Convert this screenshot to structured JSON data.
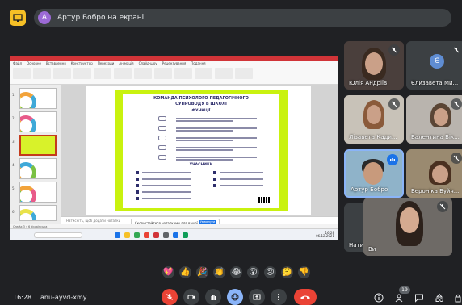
{
  "presenter_bar": {
    "avatar_letter": "А",
    "title": "Артур Бобро на екрані"
  },
  "slide": {
    "title_line1": "КОМАНДА ПСИХОЛОГО-ПЕДАГОГІЧНОГО",
    "title_line2": "СУПРОВОДУ В ШКОЛІ",
    "functions_heading": "ФУНКЦІЇ",
    "participants_heading": "УЧАСНИКИ"
  },
  "powerpoint": {
    "ribbon_tabs": [
      "Файл",
      "Основне",
      "Вставлення",
      "Конструктор",
      "Переходи",
      "Анімація",
      "Слайд-шоу",
      "Рецензування",
      "Подання"
    ],
    "thumb_numbers": [
      "1",
      "2",
      "3",
      "4",
      "5",
      "6"
    ],
    "notes_placeholder": "Натисніть, щоб додати нотатки",
    "statusbar_text": "Слайд 3 з 6   Українська",
    "toast_text": "Скористайтеся нотатками для вашої презентації",
    "toast_button": "Увімкнути",
    "taskbar_time": "16:28",
    "taskbar_date": "06.12.2021"
  },
  "participants": [
    {
      "name": "Юлія Андріїв",
      "muted": true
    },
    {
      "name": "Єлизавета Ми...",
      "muted": true,
      "avatar_letter": "Є"
    },
    {
      "name": "Лізавета Кади...",
      "muted": true
    },
    {
      "name": "Валентина Вік...",
      "muted": true
    },
    {
      "name": "Артур Бобро",
      "muted": false,
      "speaking": true
    },
    {
      "name": "Вероніка Вуйч...",
      "muted": true
    },
    {
      "name": "Нати",
      "muted": true
    },
    {
      "name": "Ви",
      "muted": true
    }
  ],
  "reactions": [
    "💖",
    "👍",
    "🎉",
    "👏",
    "😂",
    "😮",
    "😢",
    "🤔",
    "👎"
  ],
  "bottom_bar": {
    "time": "16:28",
    "meeting_code": "anu-ayvd-xmy",
    "people_count": "19"
  },
  "colors": {
    "background": "#202124",
    "control_bg": "#3c4043",
    "end_call": "#ea4335",
    "accent_blue": "#8ab4f8",
    "poster_green": "#c9f20f",
    "ppt_red": "#d13438"
  }
}
